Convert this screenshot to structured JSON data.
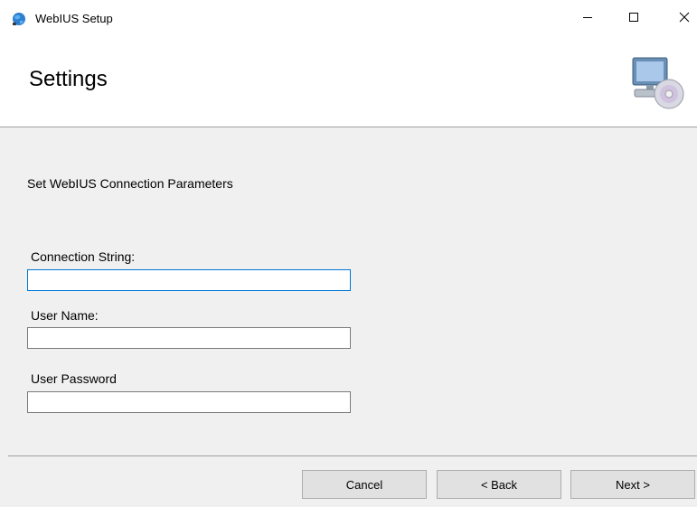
{
  "window": {
    "title": "WebIUS Setup",
    "app_icon": "setup-globe-icon",
    "controls": {
      "minimize_icon": "minimize-icon",
      "maximize_icon": "maximize-icon",
      "close_icon": "close-icon"
    }
  },
  "header": {
    "title": "Settings",
    "graphic_icon": "computer-cd-icon"
  },
  "content": {
    "heading": "Set WebIUS Connection Parameters",
    "fields": [
      {
        "label": "Connection String:",
        "value": "",
        "placeholder": "",
        "focused": true
      },
      {
        "label": "User Name:",
        "value": "",
        "placeholder": "",
        "focused": false
      },
      {
        "label": "User Password",
        "value": "",
        "placeholder": "",
        "focused": false
      }
    ]
  },
  "footer": {
    "cancel_label": "Cancel",
    "back_label": "< Back",
    "next_label": "Next >"
  },
  "colors": {
    "window_bg": "#f0f0f0",
    "header_bg": "#ffffff",
    "focus_border": "#0078d7",
    "button_bg": "#e1e1e1"
  }
}
